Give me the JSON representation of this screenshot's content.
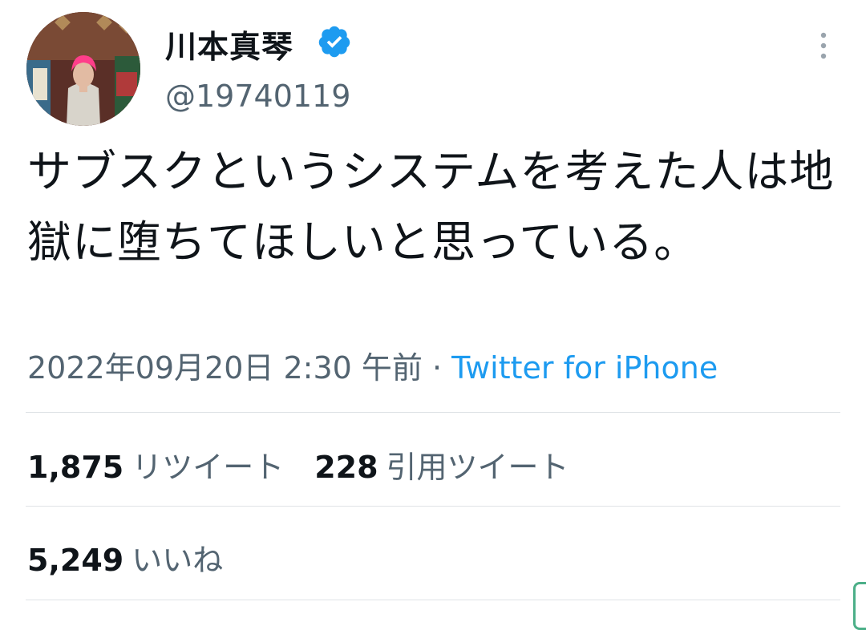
{
  "user": {
    "display_name": "川本真琴",
    "handle": "@19740119",
    "verified": true,
    "avatar_icon": "profile-photo"
  },
  "tweet": {
    "text": "サブスクというシステムを考えた人は地獄に堕ちてほしいと思っている。",
    "timestamp": "2022年09月20日 2:30 午前",
    "separator": " · ",
    "source": "Twitter for iPhone"
  },
  "stats": {
    "retweets": {
      "count": "1,875",
      "label": "リツイート"
    },
    "quotes": {
      "count": "228",
      "label": "引用ツイート"
    },
    "likes": {
      "count": "5,249",
      "label": "いいね"
    }
  },
  "colors": {
    "text": "#0f1419",
    "secondary": "#536471",
    "link": "#1d9bf0",
    "verified": "#1d9bf0",
    "divider": "#dfe3e6"
  },
  "icons": {
    "verified": "verified-badge-icon",
    "more": "more-vertical-icon"
  }
}
